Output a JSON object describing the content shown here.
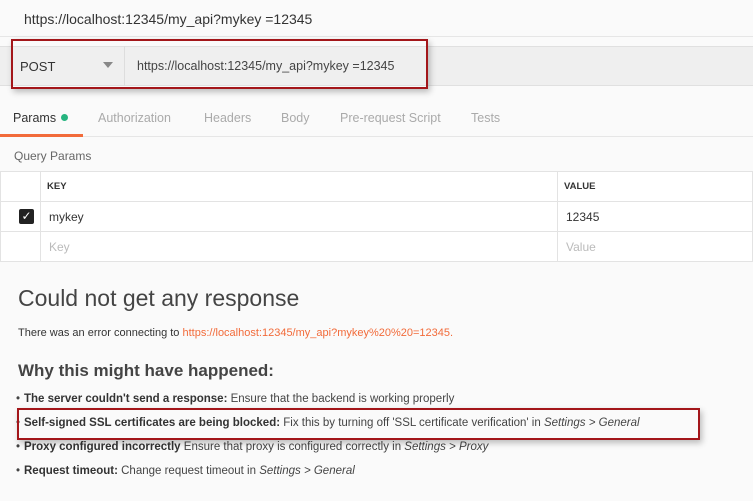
{
  "title": "https://localhost:12345/my_api?mykey =12345",
  "request": {
    "method": "POST",
    "url": "https://localhost:12345/my_api?mykey  =12345"
  },
  "tabs": [
    "Params",
    "Authorization",
    "Headers",
    "Body",
    "Pre-request Script",
    "Tests"
  ],
  "query_params": {
    "label": "Query Params",
    "headers": [
      "KEY",
      "VALUE"
    ],
    "rows": [
      {
        "checked": true,
        "key": "mykey",
        "value": "12345"
      }
    ],
    "placeholder": {
      "key": "Key",
      "value": "Value"
    }
  },
  "error": {
    "heading": "Could not get any response",
    "message": "There was an error connecting to ",
    "link": "https://localhost:12345/my_api?mykey%20%20=12345.",
    "why": "Why this might have happened:",
    "reasons": [
      {
        "bold": "The server couldn't send a response:",
        "text": " Ensure that the backend is working properly",
        "italic": ""
      },
      {
        "bold": "Self-signed SSL certificates are being blocked:",
        "text": " Fix this by turning off 'SSL certificate verification' in ",
        "italic": "Settings > General"
      },
      {
        "bold": "Proxy configured incorrectly",
        "text": " Ensure that proxy is configured correctly in ",
        "italic": "Settings > Proxy"
      },
      {
        "bold": "Request timeout:",
        "text": " Change request timeout in ",
        "italic": "Settings > General"
      }
    ]
  },
  "colors": {
    "accent": "#f26b3a",
    "highlight": "#a3161a",
    "dot": "#26b47f"
  }
}
